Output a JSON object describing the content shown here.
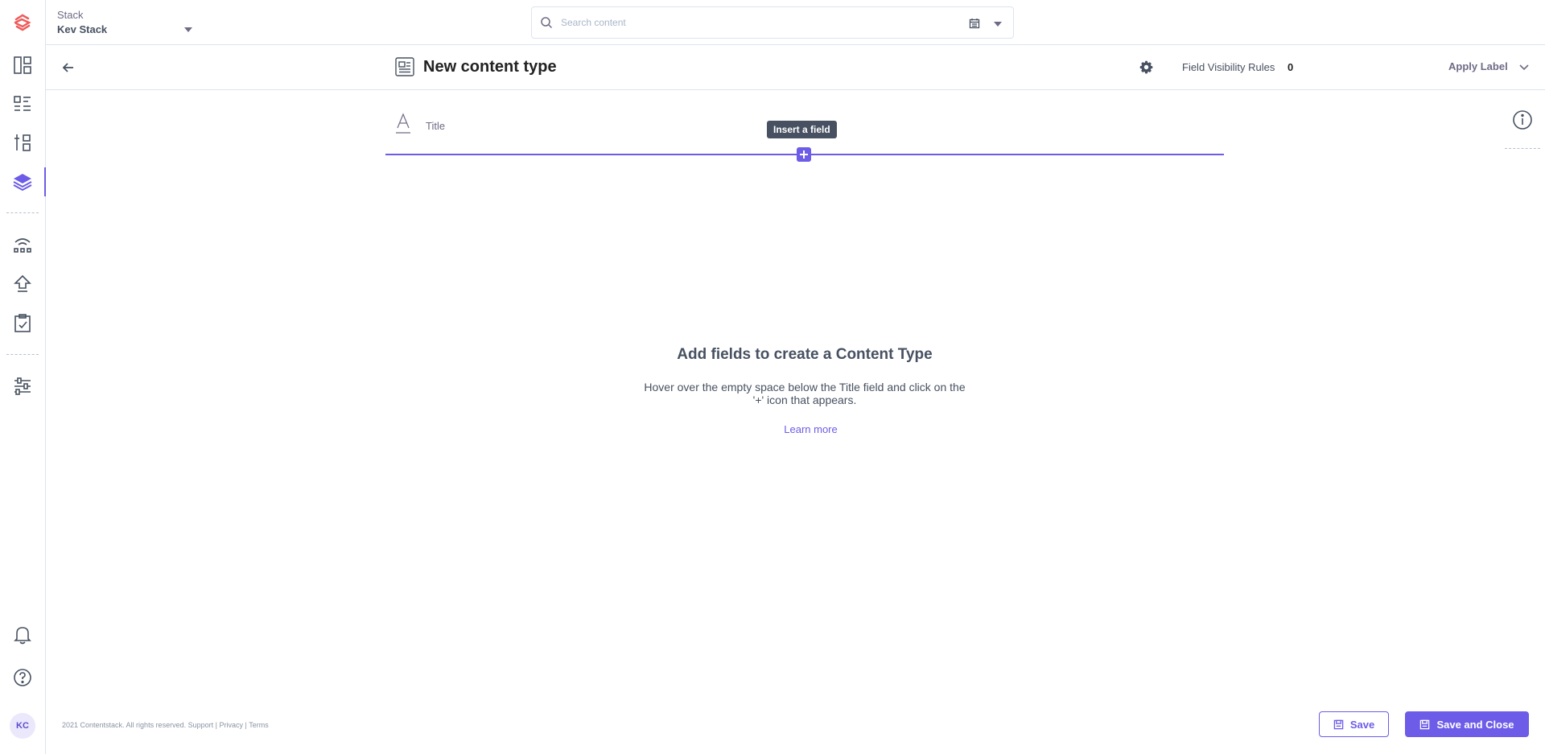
{
  "header": {
    "stack_label": "Stack",
    "stack_name": "Kev Stack",
    "search_placeholder": "Search content"
  },
  "sidebar": {
    "items": [
      {
        "icon": "dashboard-icon"
      },
      {
        "icon": "entries-icon"
      },
      {
        "icon": "content-models-icon"
      },
      {
        "icon": "content-types-icon",
        "active": true
      },
      {
        "icon": "releases-icon"
      },
      {
        "icon": "deploy-icon"
      },
      {
        "icon": "tasks-icon"
      },
      {
        "icon": "settings-sliders-icon"
      },
      {
        "icon": "notifications-icon"
      },
      {
        "icon": "help-icon"
      }
    ],
    "avatar_initials": "KC",
    "accent_color": "#6c5ce7"
  },
  "page": {
    "title": "New content type",
    "field_visibility_label": "Field Visibility Rules",
    "field_visibility_count": "0",
    "apply_label": "Apply Label"
  },
  "builder": {
    "title_field_label": "Title",
    "tooltip": "Insert a field",
    "plus": "+"
  },
  "empty_state": {
    "heading": "Add fields to create a Content Type",
    "description": "Hover over the empty space below the Title field and click on the '+' icon that appears.",
    "link": "Learn more"
  },
  "footer": {
    "copyright": "2021 Contentstack. All rights reserved.",
    "support": "Support",
    "privacy": "Privacy",
    "terms": "Terms",
    "sep": "|",
    "save_label": "Save",
    "save_close_label": "Save and Close"
  }
}
